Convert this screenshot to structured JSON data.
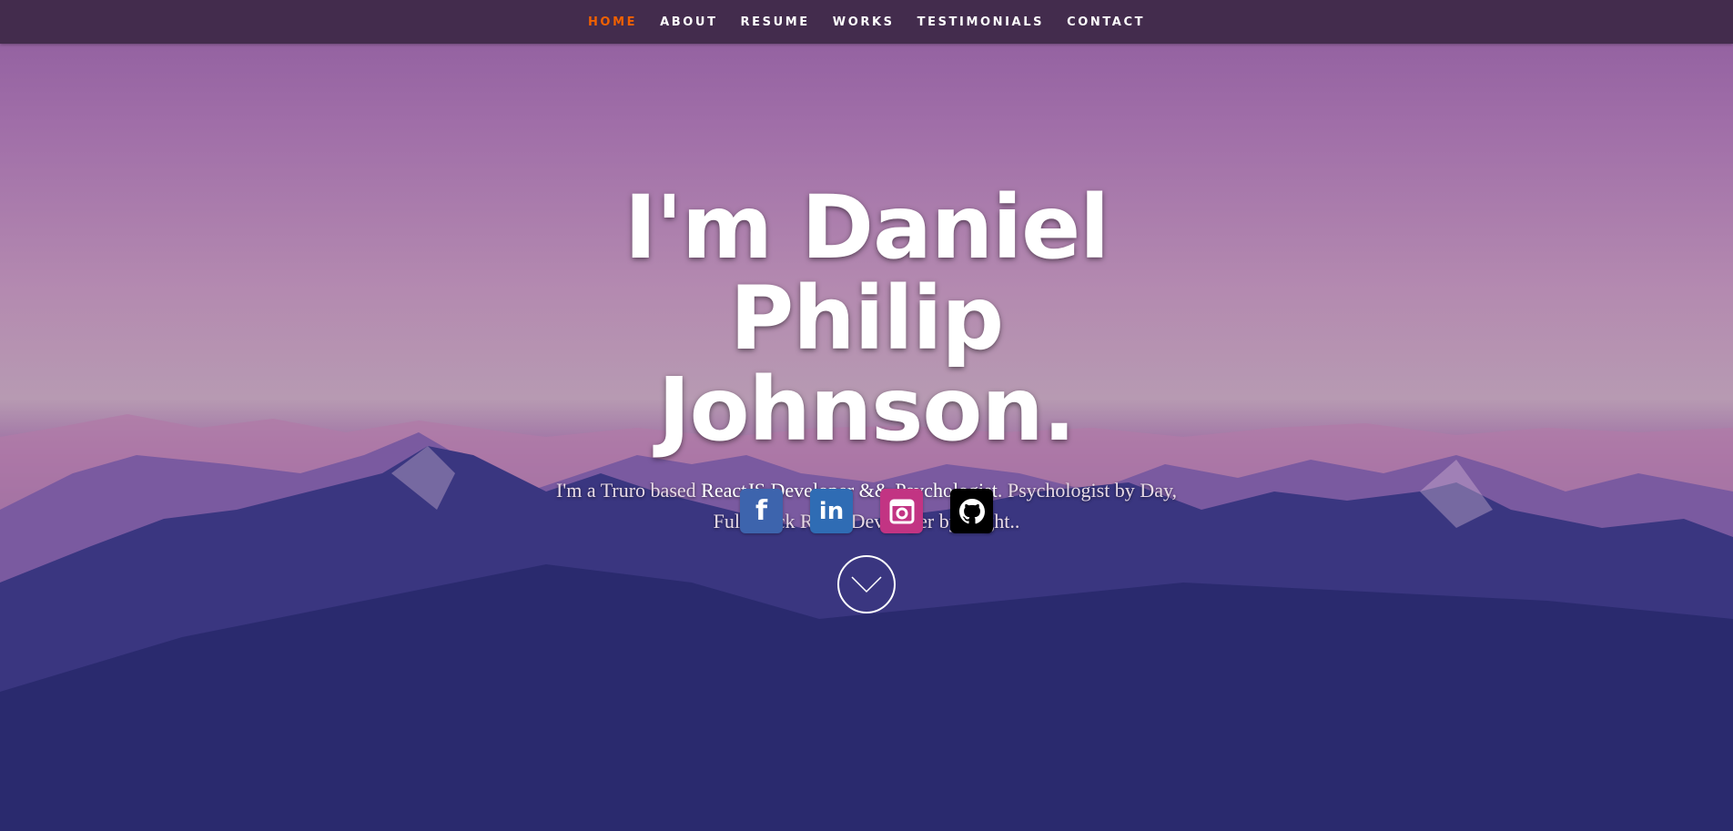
{
  "nav": {
    "items": [
      {
        "label": "HOME",
        "active": true
      },
      {
        "label": "ABOUT"
      },
      {
        "label": "RESUME"
      },
      {
        "label": "WORKS"
      },
      {
        "label": "TESTIMONIALS"
      },
      {
        "label": "CONTACT"
      }
    ],
    "active_color": "#f06000"
  },
  "hero": {
    "title": "I'm Daniel Philip Johnson.",
    "sub_pre": "I'm a Truro based ",
    "sub_role": "ReactJS Developer && Psychologist",
    "sub_post": ". Psychologist by Day, Full Stack React Developer by Night.."
  },
  "social": [
    {
      "name": "facebook-icon",
      "glyph": "f",
      "color": "#3d64ad"
    },
    {
      "name": "linkedin-icon",
      "glyph": "in",
      "color": "#2f6cb4"
    },
    {
      "name": "instagram-icon",
      "color": "#c23483"
    },
    {
      "name": "github-icon",
      "color": "#000000"
    }
  ],
  "scroll_icon": "chevron-down-circle-icon"
}
